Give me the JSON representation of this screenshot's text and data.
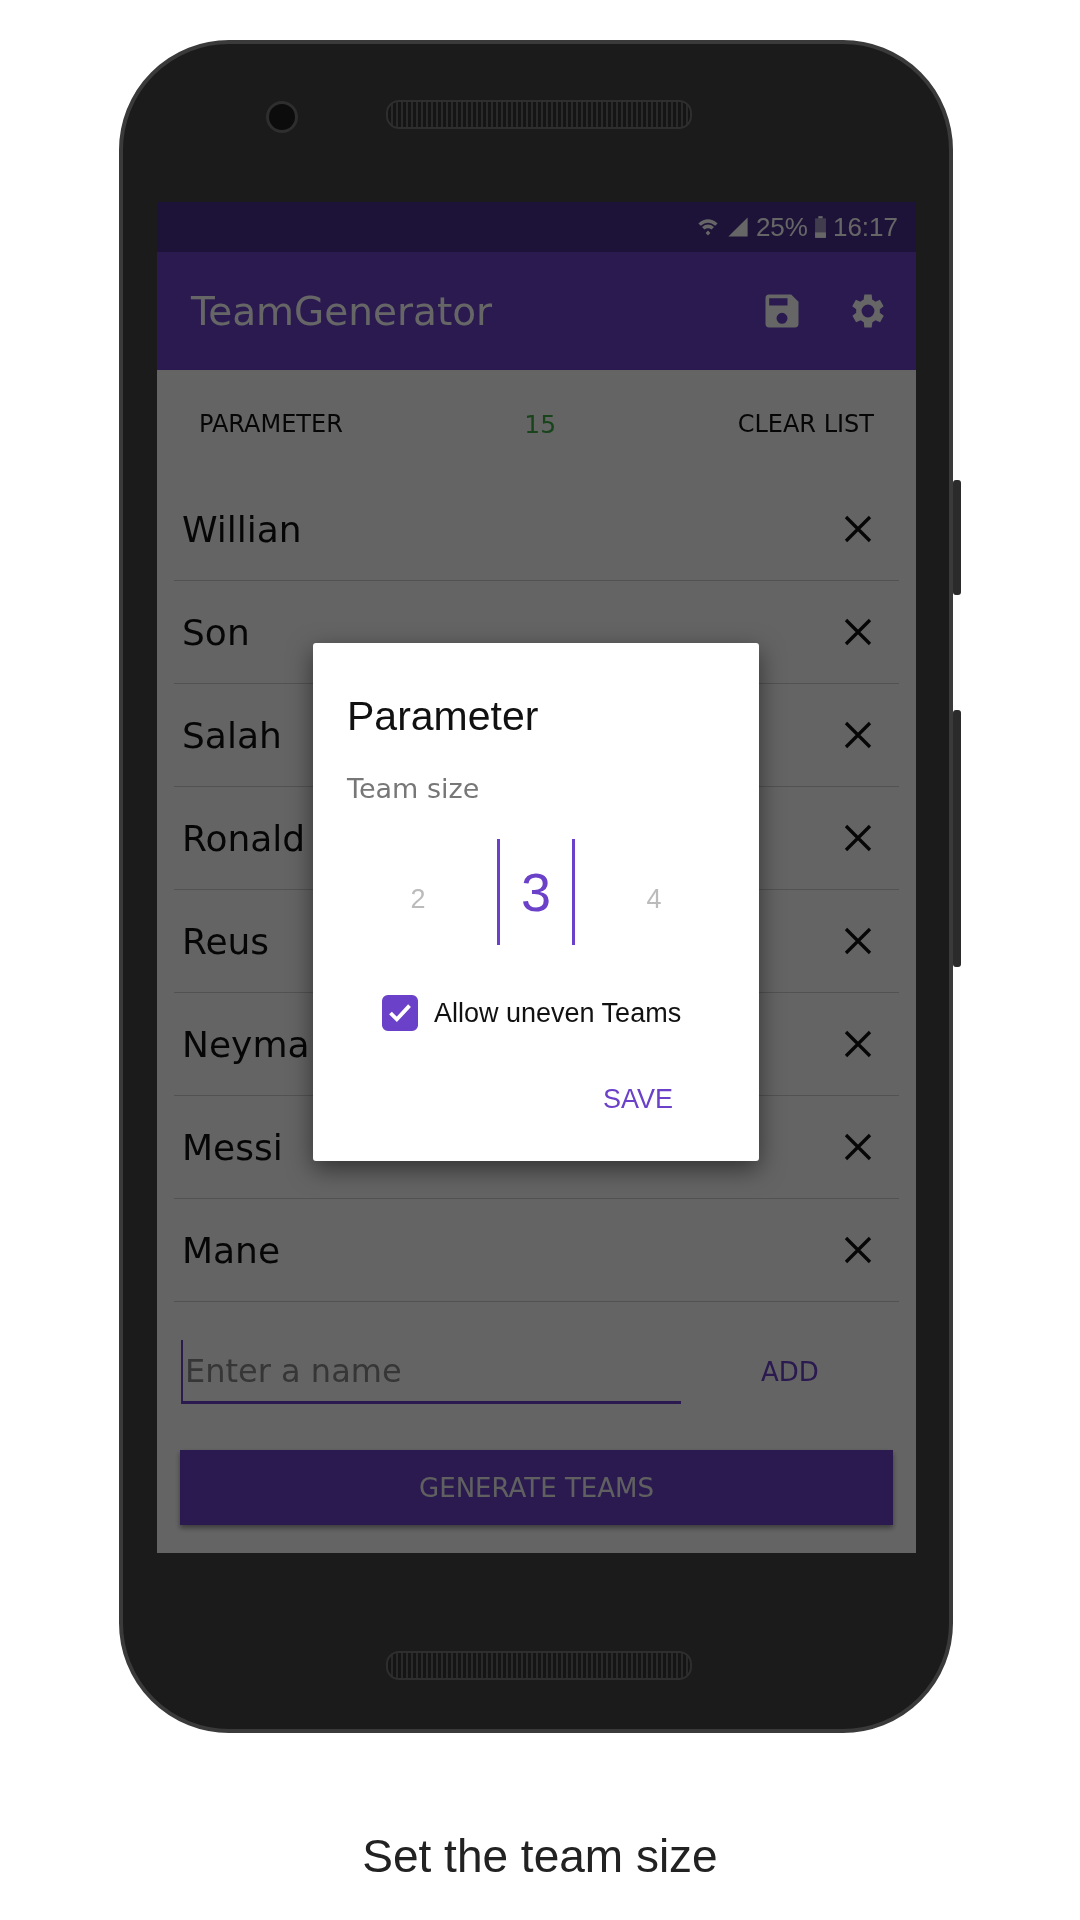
{
  "status_bar": {
    "battery": "25%",
    "time": "16:17"
  },
  "app_bar": {
    "title": "TeamGenerator"
  },
  "toolbar": {
    "parameter": "PARAMETER",
    "count": "15",
    "clear": "CLEAR LIST"
  },
  "players": [
    {
      "name": "Willian"
    },
    {
      "name": "Son"
    },
    {
      "name": "Salah"
    },
    {
      "name": "Ronald"
    },
    {
      "name": "Reus"
    },
    {
      "name": "Neyma"
    },
    {
      "name": "Messi"
    },
    {
      "name": "Mane"
    }
  ],
  "input": {
    "placeholder": "Enter a name"
  },
  "add": "ADD",
  "generate": "GENERATE TEAMS",
  "dialog": {
    "title": "Parameter",
    "label": "Team size",
    "picker": [
      {
        "value": "2",
        "selected": false
      },
      {
        "value": "3",
        "selected": true
      },
      {
        "value": "4",
        "selected": false
      }
    ],
    "checkbox": {
      "label": "Allow uneven Teams",
      "checked": true
    },
    "save": "SAVE"
  },
  "caption": "Set the team size"
}
